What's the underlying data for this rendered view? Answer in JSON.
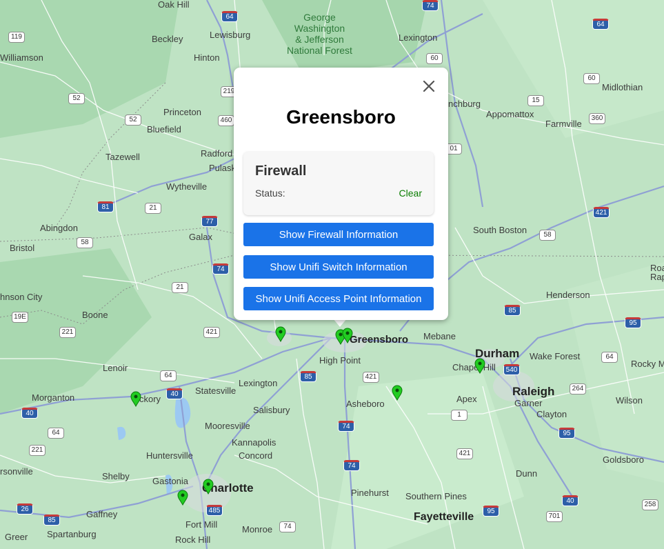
{
  "popup": {
    "title": "Greensboro",
    "card": {
      "title": "Firewall",
      "status_label": "Status:",
      "status_value": "Clear",
      "status_color": "#0a7d00"
    },
    "buttons": [
      "Show Firewall Information",
      "Show Unifi Switch Information",
      "Show Unifi Access Point Information"
    ],
    "button_color": "#1a73e8"
  },
  "map": {
    "places": {
      "oak_hill": "Oak Hill",
      "beckley": "Beckley",
      "lewisburg": "Lewisburg",
      "hinton": "Hinton",
      "williamson": "Williamson",
      "princeton": "Princeton",
      "bluefield": "Bluefield",
      "tazewell": "Tazewell",
      "radford": "Radford",
      "pulaski": "Pulaski",
      "wytheville": "Wytheville",
      "abingdon": "Abingdon",
      "bristol": "Bristol",
      "galax": "Galax",
      "johnson_city": "hnson City",
      "boone": "Boone",
      "lenoir": "Lenoir",
      "morganton": "Morganton",
      "hickory": "ckory",
      "statesville": "Statesville",
      "lexington_nc": "Lexington",
      "high_point": "High Point",
      "greensboro": "Greensboro",
      "mebane": "Mebane",
      "durham": "Durham",
      "chapel_hill": "Chapel Hill",
      "wake_forest": "Wake Forest",
      "raleigh": "Raleigh",
      "rocky_mount": "Rocky M",
      "apex": "Apex",
      "garner": "Garner",
      "clayton": "Clayton",
      "wilson": "Wilson",
      "asheboro": "Asheboro",
      "salisbury": "Salisbury",
      "mooresville": "Mooresville",
      "kannapolis": "Kannapolis",
      "concord": "Concord",
      "huntersville": "Huntersville",
      "shelby": "Shelby",
      "gastonia": "Gastonia",
      "charlotte": "Charlotte",
      "gaffney": "Gaffney",
      "spartanburg": "Spartanburg",
      "greer": "Greer",
      "fort_mill": "Fort Mill",
      "rock_hill": "Rock Hill",
      "monroe": "Monroe",
      "pinehurst": "Pinehurst",
      "southern_pines": "Southern Pines",
      "fayetteville": "Fayetteville",
      "dunn": "Dunn",
      "goldsboro": "Goldsboro",
      "lexington_va": "Lexington",
      "lynchburg": "nchburg",
      "appomattox": "Appomattox",
      "farmville": "Farmville",
      "midlothian": "Midlothian",
      "south_boston": "South Boston",
      "henderson": "Henderson",
      "roanoke_rapids_1": "Roa",
      "roanoke_rapids_2": "Rap",
      "rsonville": "rsonville",
      "forest": "George\nWashington\n& Jefferson\nNational Forest"
    },
    "shields": [
      "64",
      "64",
      "119",
      "52",
      "52",
      "460",
      "219",
      "15",
      "60",
      "360",
      "81",
      "77",
      "21",
      "58",
      "74",
      "21",
      "19E",
      "221",
      "421",
      "64",
      "40",
      "85",
      "421",
      "40",
      "74",
      "64",
      "221",
      "74",
      "85",
      "26",
      "485",
      "74",
      "95",
      "40",
      "95",
      "64",
      "540",
      "264",
      "1",
      "421",
      "701",
      "258",
      "85",
      "58",
      "60",
      "01",
      "74",
      "95",
      "421"
    ],
    "marker_color": "#22cc22"
  }
}
